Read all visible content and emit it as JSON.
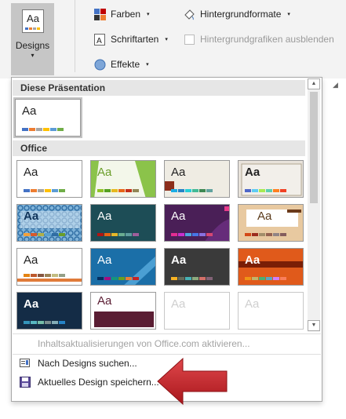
{
  "ribbon": {
    "designs_thumb_text": "Aa",
    "designs_label": "Designs",
    "designs_chevron": "▾",
    "farben": "Farben",
    "schriftarten": "Schriftarten",
    "effekte": "Effekte",
    "hintergrundformate": "Hintergrundformate",
    "hintergrundgrafiken": "Hintergrundgrafiken ausblenden",
    "dropdown_arrow": "▾",
    "launcher": "◢"
  },
  "gallery": {
    "section_current": "Diese Präsentation",
    "section_office": "Office",
    "aa": "Aa",
    "scroll_up": "▲",
    "scroll_down": "▼"
  },
  "menu": {
    "office_update": "Inhaltsaktualisierungen von Office.com aktivieren...",
    "search": "Nach Designs suchen...",
    "save": "Aktuelles Design speichern..."
  },
  "colors": {
    "accent_red": "#c0262b",
    "ribbon_bg": "#f3f3f3",
    "section_header_bg": "#e6e6e6"
  }
}
